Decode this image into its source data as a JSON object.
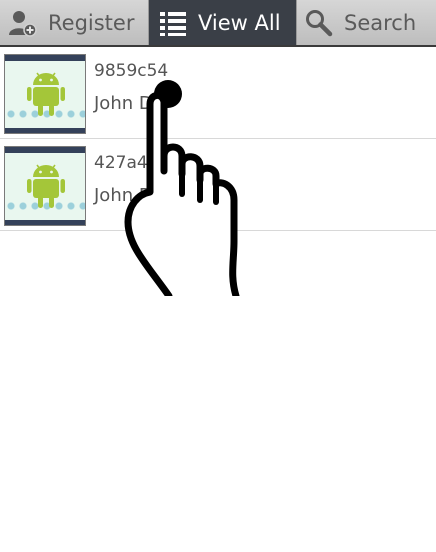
{
  "tabs": [
    {
      "label": "Register",
      "icon": "person-add-icon",
      "active": false
    },
    {
      "label": "View All",
      "icon": "list-icon",
      "active": true
    },
    {
      "label": "Search",
      "icon": "magnifier-icon",
      "active": false
    }
  ],
  "records": [
    {
      "id": "9859c54",
      "name": "John D",
      "thumbnail": "android-robot-icon"
    },
    {
      "id": "427a402",
      "name": "John Doe 2",
      "thumbnail": "android-robot-icon"
    }
  ],
  "overlay": {
    "icon": "pointing-hand-icon"
  },
  "colors": {
    "tabbar_bg": "#c9c9c9",
    "tab_active_bg": "#3a3f47",
    "tab_text": "#5a5a5a",
    "tab_active_text": "#ffffff",
    "android_green": "#a4c639",
    "thumb_frame": "#34415a"
  }
}
